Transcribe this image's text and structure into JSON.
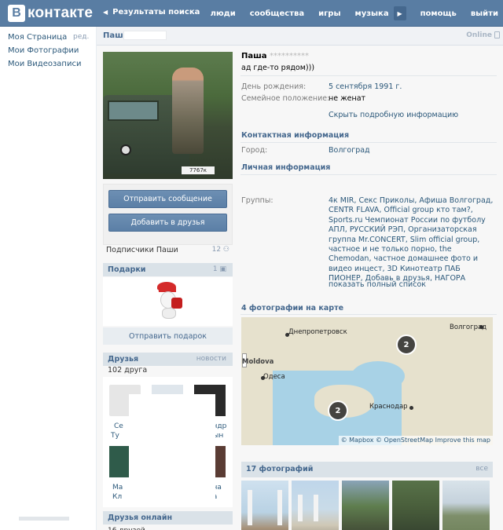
{
  "header": {
    "logo_letter": "B",
    "logo_text": "контакте",
    "back": "Результаты поиска",
    "nav": [
      "люди",
      "сообщества",
      "игры",
      "музыка",
      "помощь",
      "выйти"
    ]
  },
  "leftnav": {
    "items": [
      "Моя Страница",
      "Мои Фотографии",
      "Мои Видеозаписи"
    ],
    "edit": "ред."
  },
  "profile": {
    "header_name": "Паша",
    "online": "Online",
    "name": "Паша",
    "name_blurred": "**********",
    "status": "ад где-то рядом)))",
    "birthday_label": "День рождения:",
    "birthday_value": "5 сентября 1991 г.",
    "family_label": "Семейное положение:",
    "family_value": "не женат",
    "show_more": "Скрыть подробную информацию",
    "contact_title": "Контактная информация",
    "city_label": "Город:",
    "city_value": "Волгоград",
    "personal_title": "Личная информация",
    "groups_label": "Группы:",
    "groups_value": "4к MIR, Секс Приколы, Афиша Волгоград, CENTR FLAVA, Official group кто там?, Sports.ru Чемпионат России по футболу АПЛ, РУССКИЙ РЭП, Организаторская группа Mr.CONCERT, Slim official group, частное и не только порно, the Chemodan, частное домашнее фото и видео инцест, 3D Кинотеатр ПАБ ПИОНЕР, Добавь в друзья, НАГОРА",
    "show_all": "показать полный список"
  },
  "avatar": {
    "plate": "7767к"
  },
  "actions": {
    "send_message": "Отправить сообщение",
    "add_friend": "Добавить в друзья"
  },
  "subscribers": {
    "label": "Подписчики Паши",
    "count": "12"
  },
  "gifts": {
    "title": "Подарки",
    "count": "1",
    "send": "Отправить подарок"
  },
  "friends": {
    "title": "Друзья",
    "news": "новости",
    "count": "102 друга",
    "names": [
      "Се",
      "Ту",
      "андр",
      "дын",
      "Ма",
      "Кл",
      "ана",
      "ла"
    ]
  },
  "friends_online": {
    "title": "Друзья онлайн",
    "count": "16 друзей"
  },
  "map": {
    "title": "4 фотографии на карте",
    "cities": [
      "Днепропетровск",
      "Волгоград",
      "Moldova",
      "Одеса",
      "Краснодар"
    ],
    "pins": [
      "2",
      "2"
    ],
    "attribution": "© Mapbox © OpenStreetMap Improve this map"
  },
  "photos": {
    "title": "17 фотографий",
    "all": "все"
  }
}
